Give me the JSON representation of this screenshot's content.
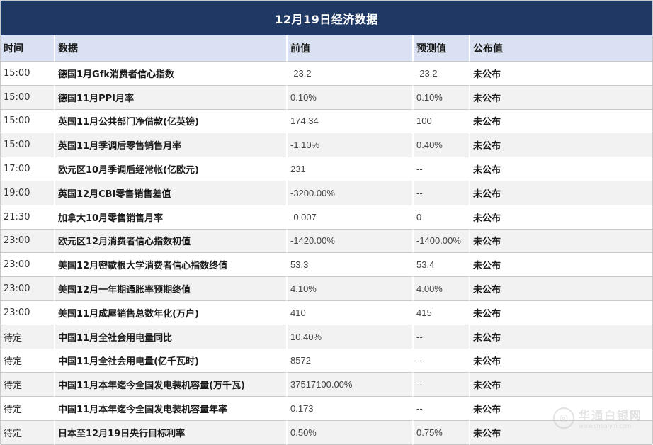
{
  "title": "12月19日经济数据",
  "headers": {
    "time": "时间",
    "data": "数据",
    "prev": "前值",
    "forecast": "预测值",
    "published": "公布值"
  },
  "rows": [
    {
      "time": "15:00",
      "name": "德国1月Gfk消费者信心指数",
      "prev": "-23.2",
      "forecast": "-23.2",
      "published": "未公布"
    },
    {
      "time": "15:00",
      "name": "德国11月PPI月率",
      "prev": "0.10%",
      "forecast": "0.10%",
      "published": "未公布"
    },
    {
      "time": "15:00",
      "name": "英国11月公共部门净借款(亿英镑)",
      "prev": "174.34",
      "forecast": "100",
      "published": "未公布"
    },
    {
      "time": "15:00",
      "name": "英国11月季调后零售销售月率",
      "prev": "-1.10%",
      "forecast": "0.40%",
      "published": "未公布"
    },
    {
      "time": "17:00",
      "name": "欧元区10月季调后经常帐(亿欧元)",
      "prev": "231",
      "forecast": "--",
      "published": "未公布"
    },
    {
      "time": "19:00",
      "name": "英国12月CBI零售销售差值",
      "prev": "-3200.00%",
      "forecast": "--",
      "published": "未公布"
    },
    {
      "time": "21:30",
      "name": "加拿大10月零售销售月率",
      "prev": "-0.007",
      "forecast": "0",
      "published": "未公布"
    },
    {
      "time": "23:00",
      "name": "欧元区12月消费者信心指数初值",
      "prev": "-1420.00%",
      "forecast": "-1400.00%",
      "published": "未公布"
    },
    {
      "time": "23:00",
      "name": "美国12月密歇根大学消费者信心指数终值",
      "prev": "53.3",
      "forecast": "53.4",
      "published": "未公布"
    },
    {
      "time": "23:00",
      "name": "美国12月一年期通胀率预期终值",
      "prev": "4.10%",
      "forecast": "4.00%",
      "published": "未公布"
    },
    {
      "time": "23:00",
      "name": "美国11月成屋销售总数年化(万户)",
      "prev": "410",
      "forecast": "415",
      "published": "未公布"
    },
    {
      "time": "待定",
      "name": "中国11月全社会用电量同比",
      "prev": "10.40%",
      "forecast": "--",
      "published": "未公布"
    },
    {
      "time": "待定",
      "name": "中国11月全社会用电量(亿千瓦时)",
      "prev": "8572",
      "forecast": "--",
      "published": "未公布"
    },
    {
      "time": "待定",
      "name": "中国11月本年迄今全国发电装机容量(万千瓦)",
      "prev": "37517100.00%",
      "forecast": "--",
      "published": "未公布"
    },
    {
      "time": "待定",
      "name": "中国11月本年迄今全国发电装机容量年率",
      "prev": "0.173",
      "forecast": "--",
      "published": "未公布"
    },
    {
      "time": "待定",
      "name": "日本至12月19日央行目标利率",
      "prev": "0.50%",
      "forecast": "0.75%",
      "published": "未公布"
    }
  ],
  "watermark": {
    "main": "华通白银网",
    "sub": "www.shbaiyin.com"
  }
}
